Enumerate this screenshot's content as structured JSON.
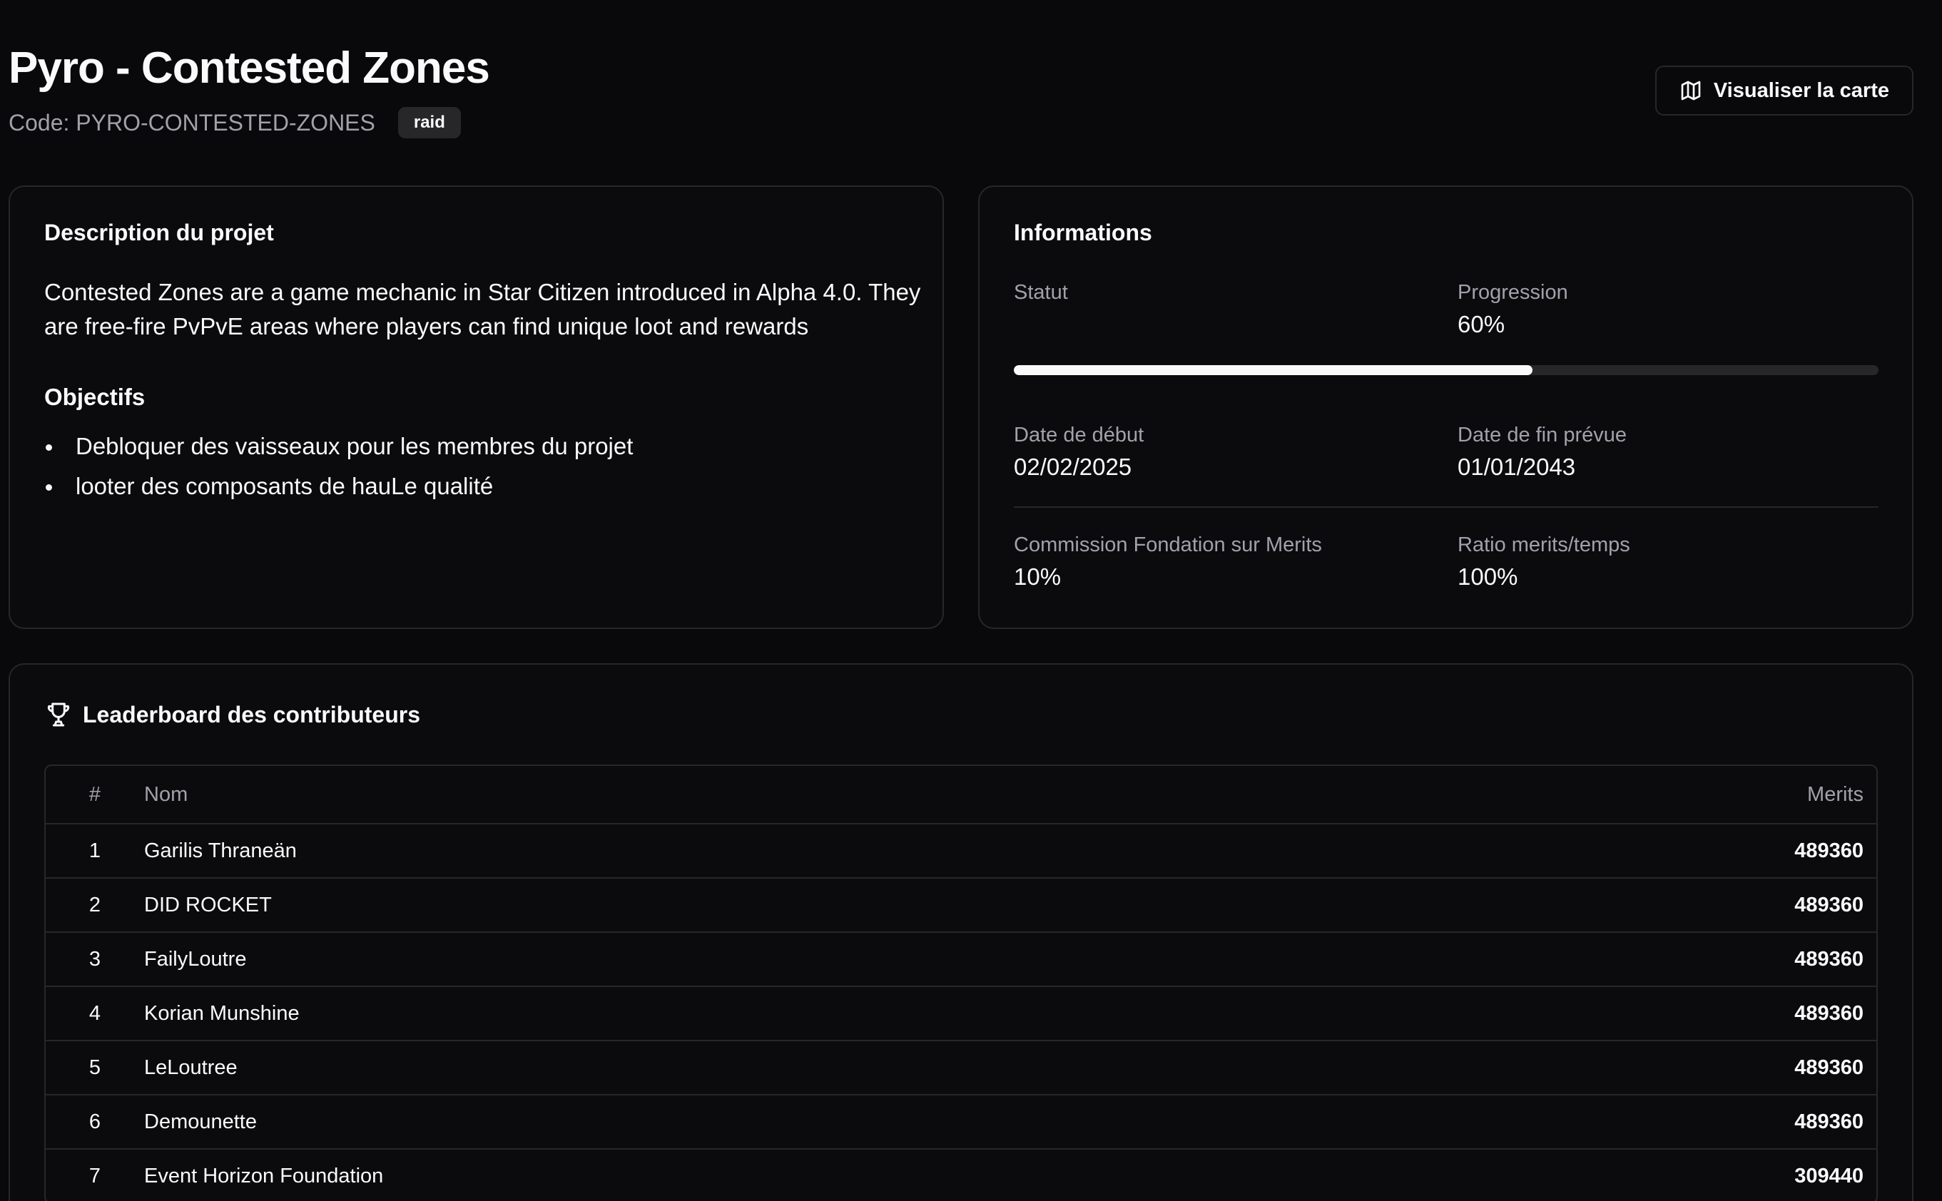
{
  "header": {
    "title": "Pyro - Contested Zones",
    "code": "Code: PYRO-CONTESTED-ZONES",
    "badge": "raid",
    "map_button": "Visualiser la carte",
    "map_icon": "map-icon"
  },
  "description": {
    "title": "Description du projet",
    "body": "Contested Zones are a game mechanic in Star Citizen introduced in Alpha 4.0. They are free-fire PvPvE areas where players can find unique loot and rewards",
    "objectives_title": "Objectifs",
    "objectives": [
      "Debloquer des vaisseaux pour les membres du projet",
      "looter des composants de hauLe qualité"
    ]
  },
  "info": {
    "title": "Informations",
    "status_label": "Statut",
    "status_value": "",
    "progress_label": "Progression",
    "progress_value": "60%",
    "progress_fraction": 0.6,
    "start_label": "Date de début",
    "start_value": "02/02/2025",
    "end_label": "Date de fin prévue",
    "end_value": "01/01/2043",
    "commission_label": "Commission Fondation sur Merits",
    "commission_value": "10%",
    "ratio_label": "Ratio merits/temps",
    "ratio_value": "100%"
  },
  "leaderboard": {
    "title": "Leaderboard des contributeurs",
    "icon": "trophy-icon",
    "columns": [
      "#",
      "Nom",
      "Merits"
    ],
    "rows": [
      {
        "rank": "1",
        "name": "Garilis Thraneän",
        "merits": "489360"
      },
      {
        "rank": "2",
        "name": "DID ROCKET",
        "merits": "489360"
      },
      {
        "rank": "3",
        "name": "FailyLoutre",
        "merits": "489360"
      },
      {
        "rank": "4",
        "name": "Korian Munshine",
        "merits": "489360"
      },
      {
        "rank": "5",
        "name": "LeLoutree",
        "merits": "489360"
      },
      {
        "rank": "6",
        "name": "Demounette",
        "merits": "489360"
      },
      {
        "rank": "7",
        "name": "Event Horizon Foundation",
        "merits": "309440"
      }
    ]
  },
  "colors": {
    "background": "#09090b",
    "border": "#27272a",
    "muted_text": "#a1a1aa",
    "text": "#fafafa"
  }
}
